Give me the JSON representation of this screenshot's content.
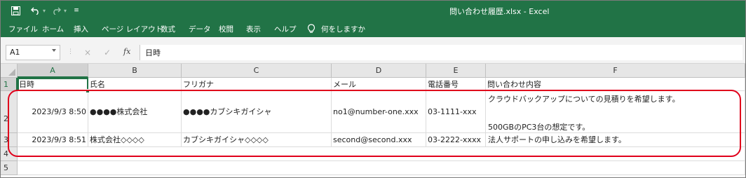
{
  "window": {
    "title": "問い合わせ履歴.xlsx  -  Excel",
    "save_icon": "save-icon",
    "undo_icon": "undo-icon",
    "redo_icon": "redo-icon",
    "customize_icon": "customize-qat-icon"
  },
  "ribbon": {
    "tabs": [
      "ファイル",
      "ホーム",
      "挿入",
      "ページ レイアウト",
      "数式",
      "データ",
      "校閲",
      "表示",
      "ヘルプ"
    ],
    "tell_me": "何をしますか"
  },
  "formula_bar": {
    "name_box": "A1",
    "cancel": "×",
    "enter": "✓",
    "fx": "fx",
    "content": "日時"
  },
  "sheet": {
    "columns": [
      "A",
      "B",
      "C",
      "D",
      "E",
      "F"
    ],
    "rows": [
      "1",
      "2",
      "3",
      "4",
      "5"
    ],
    "header": [
      "日時",
      "氏名",
      "フリガナ",
      "メール",
      "電話番号",
      "問い合わせ内容"
    ],
    "data": [
      {
        "date": "2023/9/3 8:50",
        "name": "●●●●株式会社",
        "kana": "●●●●カブシキガイシャ",
        "mail": "no1@number-one.xxx",
        "tel": "03-1111-xxx",
        "content_line1": "クラウドバックアップについての見積りを希望します。",
        "content_line2": "500GBのPC3台の想定です。"
      },
      {
        "date": "2023/9/3 8:51",
        "name": "株式会社◇◇◇◇",
        "kana": "カブシキガイシャ◇◇◇◇",
        "mail": "second@second.xxx",
        "tel": "03-2222-xxxx",
        "content_line1": "法人サポートの申し込みを希望します。"
      }
    ]
  },
  "colors": {
    "excel_green": "#217346",
    "highlight_red": "#e0001b"
  }
}
